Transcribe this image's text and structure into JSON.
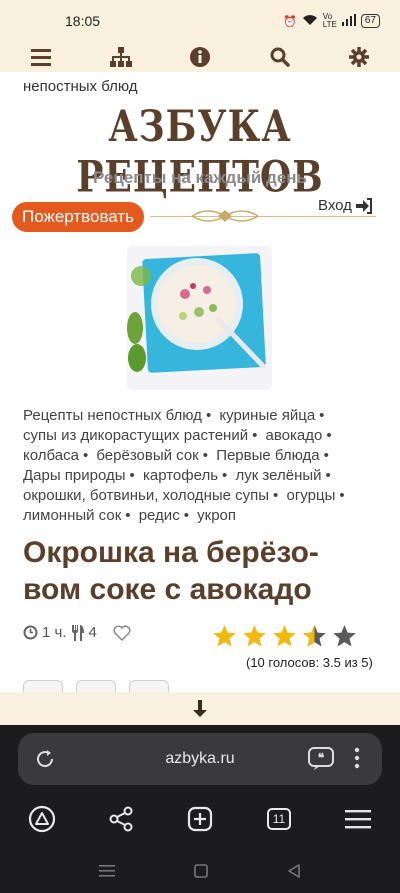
{
  "status": {
    "time": "18:05",
    "battery": "67"
  },
  "breadcrumb": "непостных блюд",
  "site": {
    "logo": "АЗБУКА РЕЦЕПТОВ",
    "tagline": "Рецепты на каждый день"
  },
  "header": {
    "donate_label": "Пожертвовать",
    "login_label": "Вход"
  },
  "tags": [
    "Рецепты непостных блюд",
    "куриные яйца",
    "супы из дикорастущих растений",
    "авокадо",
    "колбаса",
    "берёзовый сок",
    "Первые блюда",
    "Дары природы",
    "картофель",
    "лук зелёный",
    "окрошки, ботвиньи, холодные супы",
    "огурцы",
    "лимонный сок",
    "редис",
    "укроп"
  ],
  "recipe": {
    "title": "Окрошка на берёзо-вом соке с авокадо",
    "title_line1": "Окрошка на берёзо-",
    "title_line2": "вом соке с авокадо",
    "time": "1 ч.",
    "servings": "4",
    "rating": 3.5,
    "rating_max": 5,
    "votes_text": "(10 голосов: 3.5 из 5)"
  },
  "browser": {
    "url": "azbyka.ru",
    "tab_count": "11"
  },
  "colors": {
    "brand_brown": "#5a3f2b",
    "donate_orange": "#e45a1e",
    "star_gold": "#f2b90c",
    "star_grey": "#5a5a5a",
    "header_bg": "#faf0de"
  }
}
